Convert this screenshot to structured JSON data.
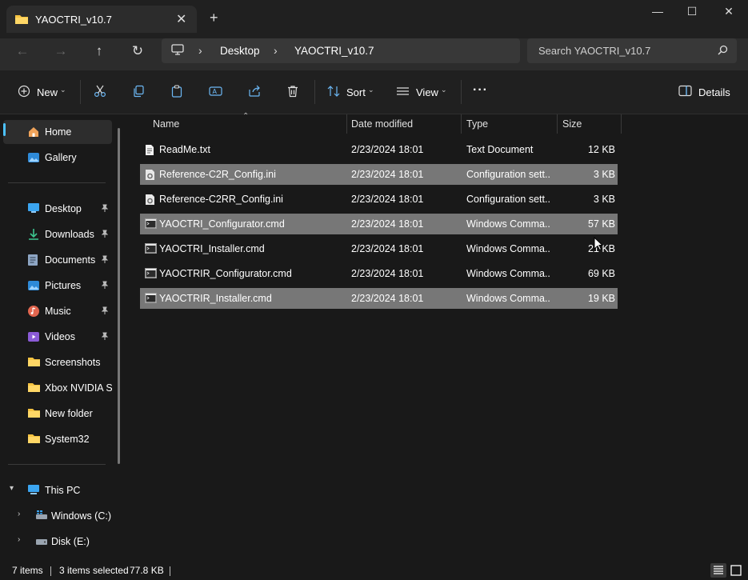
{
  "window": {
    "tab_title": "YAOCTRI_v10.7",
    "controls": {
      "minimize": "—",
      "maximize": "☐",
      "close": "✕"
    },
    "new_tab": "+"
  },
  "address": {
    "crumbs": [
      "Desktop",
      "YAOCTRI_v10.7"
    ],
    "search_placeholder": "Search YAOCTRI_v10.7"
  },
  "toolbar": {
    "new_label": "New",
    "sort_label": "Sort",
    "view_label": "View",
    "more_label": "···",
    "details_label": "Details"
  },
  "nav": {
    "home": "Home",
    "gallery": "Gallery",
    "pinned": [
      "Desktop",
      "Downloads",
      "Documents",
      "Pictures",
      "Music",
      "Videos"
    ],
    "folders": [
      "Screenshots",
      "Xbox NVIDIA Ste",
      "New folder",
      "System32"
    ],
    "this_pc": "This PC",
    "drives": [
      "Windows (C:)",
      "Disk (E:)"
    ]
  },
  "columns": {
    "name": "Name",
    "date": "Date modified",
    "type": "Type",
    "size": "Size"
  },
  "files": [
    {
      "name": "ReadMe.txt",
      "date": "2/23/2024 18:01",
      "type": "Text Document",
      "size": "12 KB",
      "selected": false,
      "icon": "text-file-icon"
    },
    {
      "name": "Reference-C2R_Config.ini",
      "date": "2/23/2024 18:01",
      "type": "Configuration sett...",
      "size": "3 KB",
      "selected": true,
      "icon": "config-file-icon"
    },
    {
      "name": "Reference-C2RR_Config.ini",
      "date": "2/23/2024 18:01",
      "type": "Configuration sett...",
      "size": "3 KB",
      "selected": false,
      "icon": "config-file-icon"
    },
    {
      "name": "YAOCTRI_Configurator.cmd",
      "date": "2/23/2024 18:01",
      "type": "Windows Comma...",
      "size": "57 KB",
      "selected": true,
      "icon": "cmd-file-icon"
    },
    {
      "name": "YAOCTRI_Installer.cmd",
      "date": "2/23/2024 18:01",
      "type": "Windows Comma...",
      "size": "21 KB",
      "selected": false,
      "icon": "cmd-file-icon"
    },
    {
      "name": "YAOCTRIR_Configurator.cmd",
      "date": "2/23/2024 18:01",
      "type": "Windows Comma...",
      "size": "69 KB",
      "selected": false,
      "icon": "cmd-file-icon"
    },
    {
      "name": "YAOCTRIR_Installer.cmd",
      "date": "2/23/2024 18:01",
      "type": "Windows Comma...",
      "size": "19 KB",
      "selected": true,
      "icon": "cmd-file-icon"
    }
  ],
  "status": {
    "items": "7 items",
    "selected": "3 items selected",
    "selected_size": "77.8 KB"
  },
  "colors": {
    "accent": "#4cc2ff",
    "folder": "#f5c342",
    "selection": "#777777",
    "background": "#191919"
  }
}
